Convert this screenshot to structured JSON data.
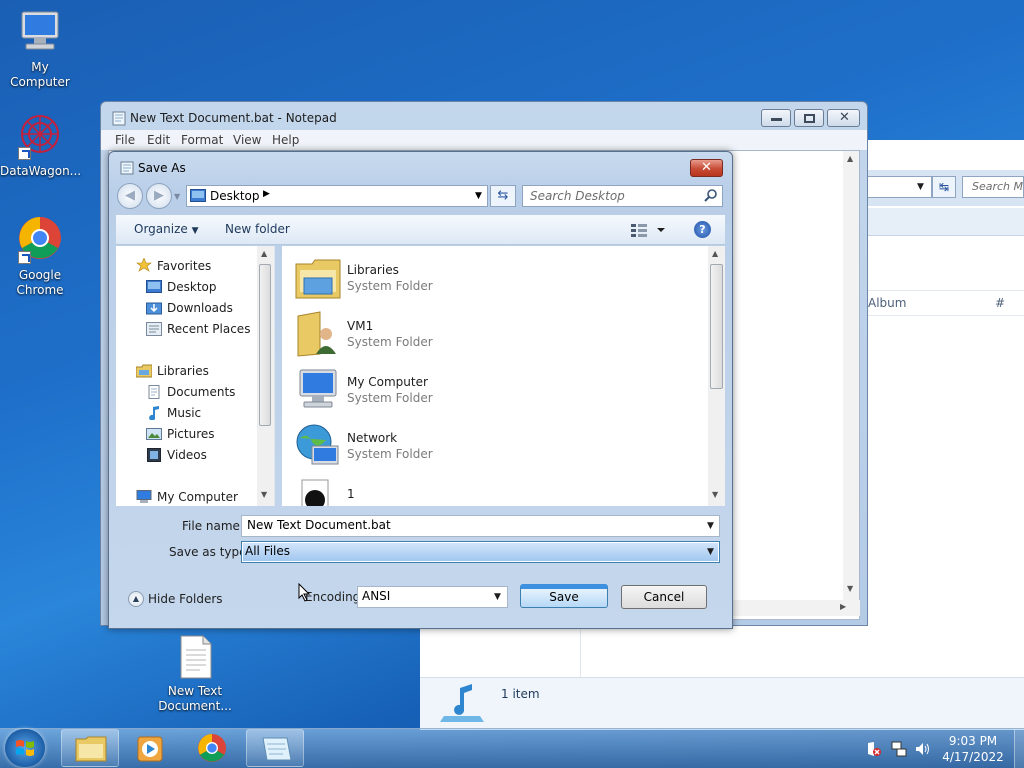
{
  "desktop": {
    "icons": [
      {
        "label": "My Computer"
      },
      {
        "label": "DataWagon..."
      },
      {
        "label": "Google Chrome"
      },
      {
        "label": "New Text Document..."
      }
    ]
  },
  "background_window": {
    "search_placeholder": "Search Mu",
    "columns": [
      "Album",
      "#"
    ],
    "status": "1 item"
  },
  "notepad": {
    "title": "New Text Document.bat - Notepad",
    "menu": [
      "File",
      "Edit",
      "Format",
      "View",
      "Help"
    ]
  },
  "save_as": {
    "title": "Save As",
    "address": "Desktop",
    "search_placeholder": "Search Desktop",
    "toolbar": {
      "organize": "Organize",
      "new_folder": "New folder"
    },
    "nav": {
      "favorites": "Favorites",
      "favorites_items": [
        "Desktop",
        "Downloads",
        "Recent Places"
      ],
      "libraries": "Libraries",
      "libraries_items": [
        "Documents",
        "Music",
        "Pictures",
        "Videos"
      ],
      "computer": "My Computer"
    },
    "files": [
      {
        "name": "Libraries",
        "type": "System Folder"
      },
      {
        "name": "VM1",
        "type": "System Folder"
      },
      {
        "name": "My Computer",
        "type": "System Folder"
      },
      {
        "name": "Network",
        "type": "System Folder"
      },
      {
        "name": "1",
        "type": ""
      }
    ],
    "file_name_label": "File name:",
    "file_name_value": "New Text Document.bat",
    "save_type_label": "Save as type:",
    "save_type_value": "All Files",
    "hide_folders": "Hide Folders",
    "encoding_label": "Encoding:",
    "encoding_value": "ANSI",
    "save_button": "Save",
    "cancel_button": "Cancel"
  },
  "taskbar": {
    "time": "9:03 PM",
    "date": "4/17/2022"
  }
}
